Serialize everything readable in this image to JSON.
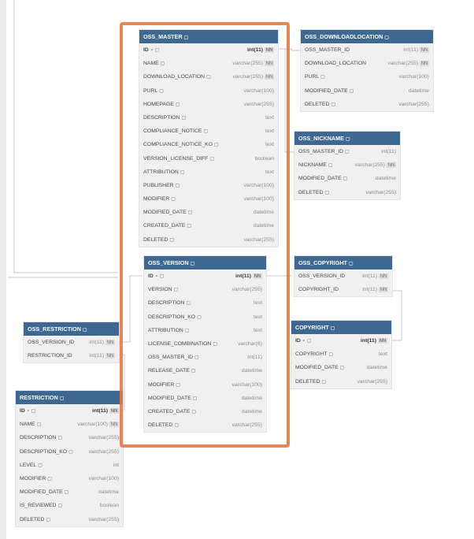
{
  "tables": [
    {
      "key": "oss_master",
      "title": "OSS_MASTER",
      "cols": [
        {
          "name": "ID",
          "type": "int(11)",
          "nn": true,
          "pk": true
        },
        {
          "name": "NAME",
          "type": "varchar(255)",
          "nn": true
        },
        {
          "name": "DOWNLOAD_LOCATION",
          "type": "varchar(255)",
          "nn": true
        },
        {
          "name": "PURL",
          "type": "varchar(100)"
        },
        {
          "name": "HOMEPAGE",
          "type": "varchar(255)"
        },
        {
          "name": "DESCRIPTION",
          "type": "text"
        },
        {
          "name": "COMPLIANCE_NOTICE",
          "type": "text"
        },
        {
          "name": "COMPLIANCE_NOTICE_KO",
          "type": "text"
        },
        {
          "name": "VERSION_LICENSE_DIFF",
          "type": "boolean"
        },
        {
          "name": "ATTRIBUTION",
          "type": "text"
        },
        {
          "name": "PUBLISHER",
          "type": "varchar(100)"
        },
        {
          "name": "MODIFIER",
          "type": "varchar(100)"
        },
        {
          "name": "MODIFIED_DATE",
          "type": "datetime"
        },
        {
          "name": "CREATED_DATE",
          "type": "datetime"
        },
        {
          "name": "DELETED",
          "type": "varchar(255)"
        }
      ]
    },
    {
      "key": "oss_downloadlocation",
      "title": "OSS_DOWNLOADLOCATION",
      "cols": [
        {
          "name": "OSS_MASTER_ID",
          "type": "int(11)",
          "nn": true,
          "plain": true
        },
        {
          "name": "DOWNLOAD_LOCATION",
          "type": "varchar(255)",
          "nn": true,
          "plain": true
        },
        {
          "name": "PURL",
          "type": "varchar(100)"
        },
        {
          "name": "MODIFIED_DATE",
          "type": "datetime"
        },
        {
          "name": "DELETED",
          "type": "varchar(255)"
        }
      ]
    },
    {
      "key": "oss_nickname",
      "title": "OSS_NICKNAME",
      "cols": [
        {
          "name": "OSS_MASTER_ID",
          "type": "int(11)"
        },
        {
          "name": "NICKNAME",
          "type": "varchar(255)",
          "nn": true
        },
        {
          "name": "MODIFIED_DATE",
          "type": "datetime"
        },
        {
          "name": "DELETED",
          "type": "varchar(255)"
        }
      ]
    },
    {
      "key": "oss_version",
      "title": "OSS_VERSION",
      "cols": [
        {
          "name": "ID",
          "type": "int(11)",
          "nn": true,
          "pk": true
        },
        {
          "name": "VERSION",
          "type": "varchar(255)"
        },
        {
          "name": "DESCRIPTION",
          "type": "text"
        },
        {
          "name": "DESCRIPTION_KO",
          "type": "text"
        },
        {
          "name": "ATTRIBUTION",
          "type": "text"
        },
        {
          "name": "LICENSE_COMBINATION",
          "type": "varchar(6)"
        },
        {
          "name": "OSS_MASTER_ID",
          "type": "int(11)"
        },
        {
          "name": "RELEASE_DATE",
          "type": "datetime"
        },
        {
          "name": "MODIFIER",
          "type": "varchar(100)"
        },
        {
          "name": "MODIFIED_DATE",
          "type": "datetime"
        },
        {
          "name": "CREATED_DATE",
          "type": "datetime"
        },
        {
          "name": "DELETED",
          "type": "varchar(255)"
        }
      ]
    },
    {
      "key": "oss_copyright",
      "title": "OSS_COPYRIGHT",
      "cols": [
        {
          "name": "OSS_VERSION_ID",
          "type": "int(11)",
          "nn": true,
          "plain": true
        },
        {
          "name": "COPYRIGHT_ID",
          "type": "int(11)",
          "nn": true,
          "plain": true
        }
      ]
    },
    {
      "key": "copyright",
      "title": "COPYRIGHT",
      "cols": [
        {
          "name": "ID",
          "type": "int(11)",
          "nn": true,
          "pk": true
        },
        {
          "name": "COPYRIGHT",
          "type": "text"
        },
        {
          "name": "MODIFIED_DATE",
          "type": "datetime"
        },
        {
          "name": "DELETED",
          "type": "varchar(255)"
        }
      ]
    },
    {
      "key": "oss_restriction",
      "title": "OSS_RESTRICTION",
      "cols": [
        {
          "name": "OSS_VERSION_ID",
          "type": "int(11)",
          "nn": true,
          "plain": true
        },
        {
          "name": "RESTRICTION_ID",
          "type": "int(11)",
          "nn": true,
          "plain": true
        }
      ]
    },
    {
      "key": "restriction",
      "title": "RESTRICTION",
      "cols": [
        {
          "name": "ID",
          "type": "int(11)",
          "nn": true,
          "pk": true
        },
        {
          "name": "NAME",
          "type": "varchar(100)",
          "nn": true
        },
        {
          "name": "DESCRIPTION",
          "type": "varchar(255)"
        },
        {
          "name": "DESCRIPTION_KO",
          "type": "varchar(255)"
        },
        {
          "name": "LEVEL",
          "type": "int"
        },
        {
          "name": "MODIFIER",
          "type": "varchar(100)"
        },
        {
          "name": "MODIFIED_DATE",
          "type": "datetime"
        },
        {
          "name": "IS_REVIEWED",
          "type": "boolean"
        },
        {
          "name": "DELETED",
          "type": "varchar(255)"
        }
      ]
    }
  ],
  "badges": {
    "not_null": "NN"
  },
  "icons": {
    "comment": "comment-icon",
    "key": "key-icon"
  },
  "colors": {
    "header": "#3e6791",
    "highlight": "#e07b43",
    "row_bg": "#f0f0f0"
  }
}
